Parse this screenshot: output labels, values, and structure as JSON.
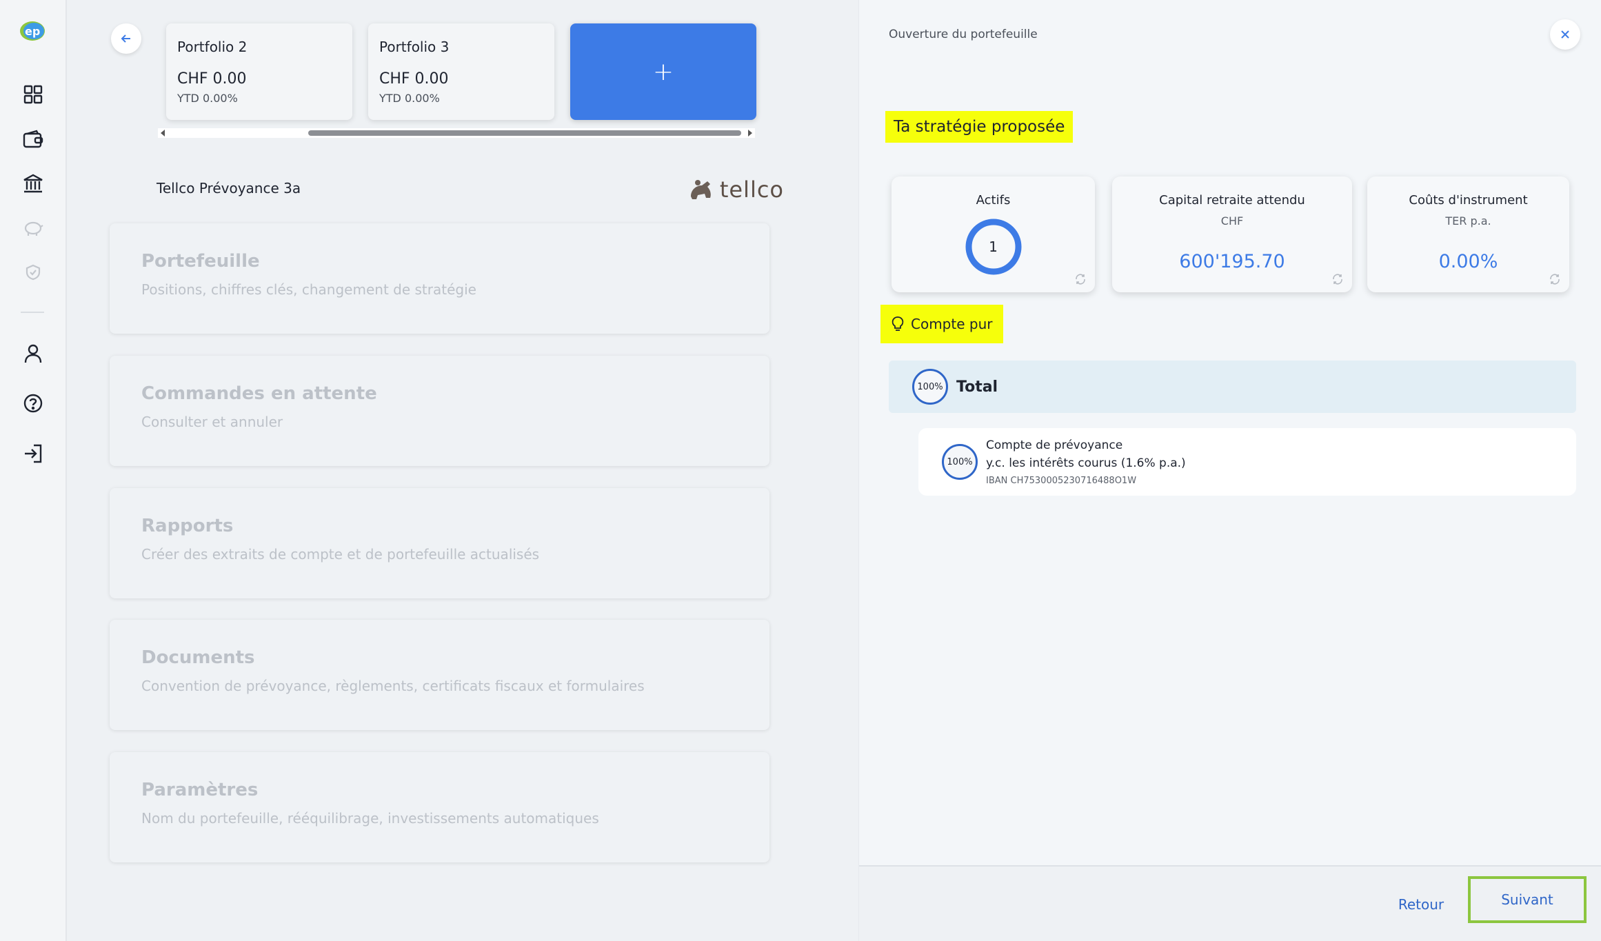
{
  "sidebar": {
    "logo_text": "ep",
    "items": [
      {
        "icon": "dashboard-grid-icon"
      },
      {
        "icon": "wallet-icon"
      },
      {
        "icon": "bank-icon"
      },
      {
        "icon": "piggy-bank-icon"
      },
      {
        "icon": "shield-icon"
      },
      {
        "icon": "user-icon"
      },
      {
        "icon": "help-icon"
      },
      {
        "icon": "logout-icon"
      }
    ]
  },
  "portfolios": [
    {
      "name": "Portfolio 2",
      "amount": "CHF 0.00",
      "ytd": "YTD 0.00%"
    },
    {
      "name": "Portfolio 3",
      "amount": "CHF 0.00",
      "ytd": "YTD 0.00%"
    }
  ],
  "add_portfolio_label": "+",
  "product": {
    "name": "Tellco Prévoyance 3a",
    "brand_logo_text": "tellco"
  },
  "menu": [
    {
      "title": "Portefeuille",
      "subtitle": "Positions, chiffres clés, changement de stratégie"
    },
    {
      "title": "Commandes en attente",
      "subtitle": "Consulter et annuler"
    },
    {
      "title": "Rapports",
      "subtitle": "Créer des extraits de compte et de portefeuille actualisés"
    },
    {
      "title": "Documents",
      "subtitle": "Convention de prévoyance, règlements, certificats fiscaux et formulaires"
    },
    {
      "title": "Paramètres",
      "subtitle": "Nom du portefeuille, rééquilibrage, investissements automatiques"
    }
  ],
  "panel": {
    "title": "Ouverture du portefeuille",
    "strategy_heading": "Ta stratégie proposée",
    "kpis": {
      "assets": {
        "title": "Actifs",
        "value": "1"
      },
      "capital": {
        "title": "Capital retraite attendu",
        "sub": "CHF",
        "value": "600'195.70"
      },
      "costs": {
        "title": "Coûts d'instrument",
        "sub": "TER p.a.",
        "value": "0.00%"
      }
    },
    "tip_label": "Compte pur",
    "total": {
      "pct": "100%",
      "label": "Total"
    },
    "account": {
      "pct": "100%",
      "line1": "Compte de prévoyance",
      "line2": "y.c. les intérêts courus (1.6% p.a.)",
      "iban": "IBAN CH7530005230716488O1W"
    },
    "footer": {
      "back": "Retour",
      "next": "Suivant"
    }
  },
  "colors": {
    "accent": "#3d7be6",
    "highlight": "#f6ff0b",
    "next_border": "#8cc63f"
  }
}
